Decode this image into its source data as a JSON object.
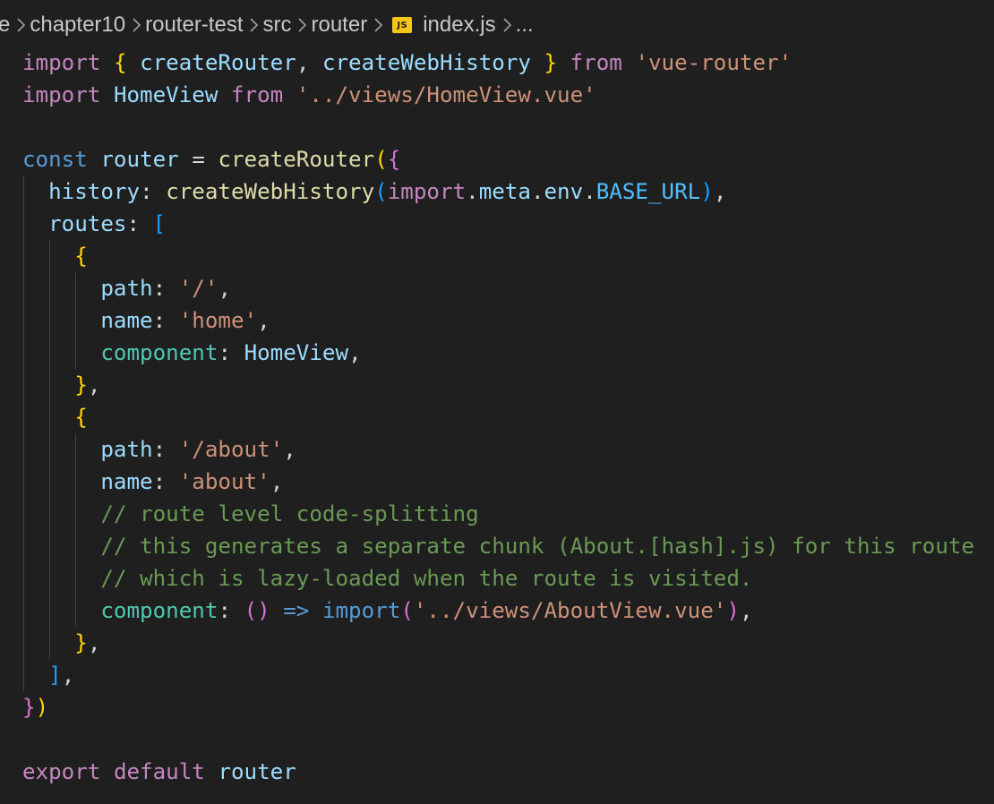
{
  "breadcrumb": {
    "items": [
      "e",
      "chapter10",
      "router-test",
      "src",
      "router",
      "index.js",
      "..."
    ],
    "file_icon_label": "JS",
    "file_icon": "javascript-file-icon",
    "separator_icon": "chevron-right-icon"
  },
  "code": {
    "language": "javascript",
    "lines": [
      "import { createRouter, createWebHistory } from 'vue-router'",
      "import HomeView from '../views/HomeView.vue'",
      "",
      "const router = createRouter({",
      "  history: createWebHistory(import.meta.env.BASE_URL),",
      "  routes: [",
      "    {",
      "      path: '/',",
      "      name: 'home',",
      "      component: HomeView,",
      "    },",
      "    {",
      "      path: '/about',",
      "      name: 'about',",
      "      // route level code-splitting",
      "      // this generates a separate chunk (About.[hash].js) for this route",
      "      // which is lazy-loaded when the route is visited.",
      "      component: () => import('../views/AboutView.vue'),",
      "    },",
      "  ],",
      "})",
      "",
      "export default router"
    ]
  },
  "colors": {
    "background": "#1f1f1f",
    "keyword": "#c586c0",
    "string": "#ce9178",
    "function": "#dcdcaa",
    "variable": "#9cdcfe",
    "comment": "#6a9955",
    "js_badge": "#f5c518"
  }
}
